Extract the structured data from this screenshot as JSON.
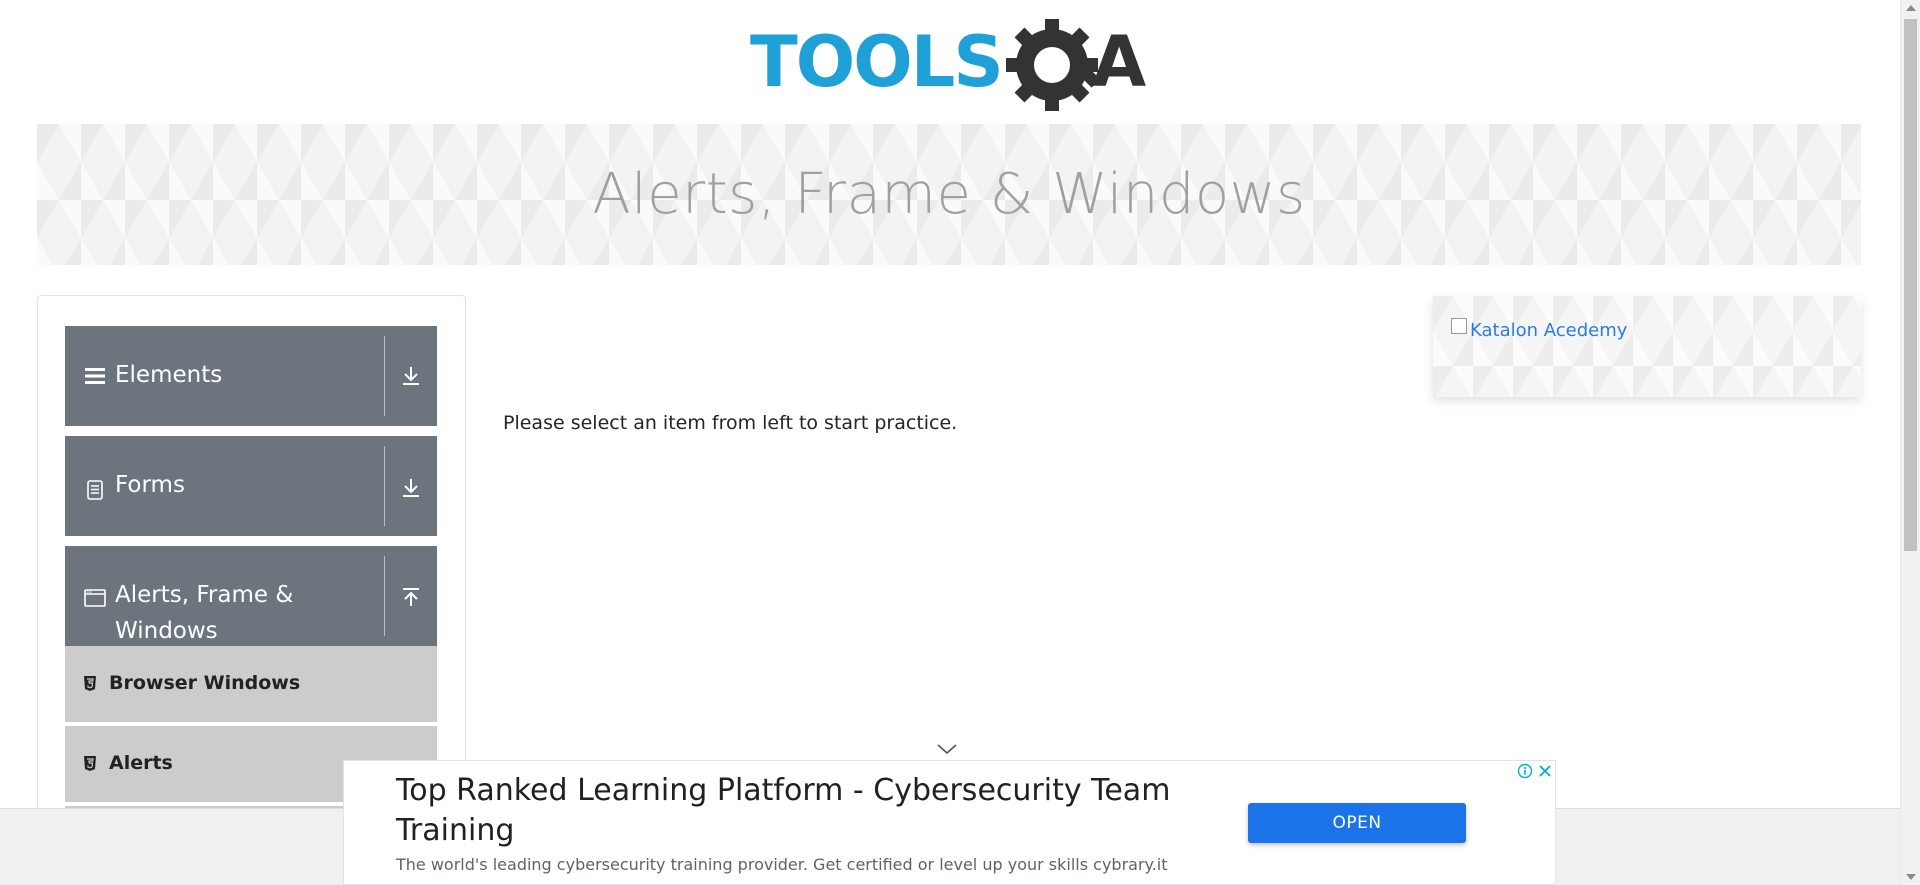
{
  "header": {
    "logo_text_left": "TOOLS",
    "logo_text_right": "A",
    "banner_title": "Alerts, Frame & Windows"
  },
  "sidebar": {
    "groups": [
      {
        "label": "Elements",
        "icon": "hamburger-icon",
        "toggle_icon": "download-arrow-icon",
        "expanded": false
      },
      {
        "label": "Forms",
        "icon": "document-icon",
        "toggle_icon": "download-arrow-icon",
        "expanded": false
      },
      {
        "label": "Alerts, Frame & Windows",
        "label_line1": "Alerts, Frame &",
        "label_line2": "Windows",
        "icon": "window-icon",
        "toggle_icon": "upload-arrow-icon",
        "expanded": true
      }
    ],
    "sub_items": [
      {
        "label": "Browser Windows",
        "icon": "html5-icon"
      },
      {
        "label": "Alerts",
        "icon": "html5-icon"
      }
    ]
  },
  "main": {
    "instruction": "Please select an item from left to start practice."
  },
  "promo": {
    "alt_text": "Katalon Acedemy"
  },
  "ad": {
    "title": "Top Ranked Learning Platform - Cybersecurity Team Training",
    "description": "The world's leading cybersecurity training provider. Get certified or level up your skills cybrary.it",
    "button_label": "OPEN"
  },
  "colors": {
    "sidebar_header_bg": "#6c757d",
    "sidebar_subitem_bg": "#cccccc",
    "logo_blue": "#1fa1d8",
    "logo_dark": "#333333",
    "ad_button": "#1a73e8",
    "link_blue": "#2c7be5"
  }
}
